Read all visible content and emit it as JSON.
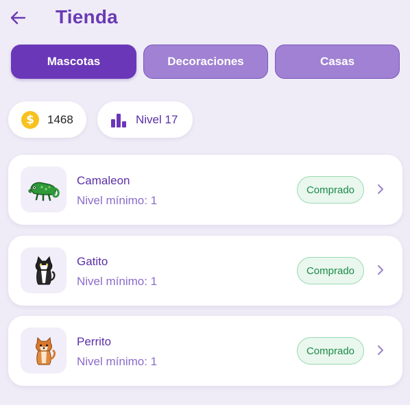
{
  "header": {
    "back_icon": "arrow-left-icon",
    "title": "Tienda"
  },
  "tabs": [
    {
      "label": "Mascotas",
      "active": true
    },
    {
      "label": "Decoraciones",
      "active": false
    },
    {
      "label": "Casas",
      "active": false
    }
  ],
  "stats": {
    "coins": {
      "icon": "coin-icon",
      "symbol": "$",
      "value": "1468"
    },
    "level": {
      "icon": "bar-chart-icon",
      "label": "Nivel 17"
    }
  },
  "items": [
    {
      "name": "Camaleon",
      "min_level": "Nivel mínimo: 1",
      "status": "Comprado",
      "icon": "chameleon-icon"
    },
    {
      "name": "Gatito",
      "min_level": "Nivel mínimo: 1",
      "status": "Comprado",
      "icon": "cat-icon"
    },
    {
      "name": "Perrito",
      "min_level": "Nivel mínimo: 1",
      "status": "Comprado",
      "icon": "dog-icon"
    }
  ],
  "colors": {
    "accent": "#6a37b8",
    "tab_inactive": "#a081d3",
    "background": "#efecf7",
    "badge_text": "#1b8a47",
    "coin": "#f7c21f"
  }
}
